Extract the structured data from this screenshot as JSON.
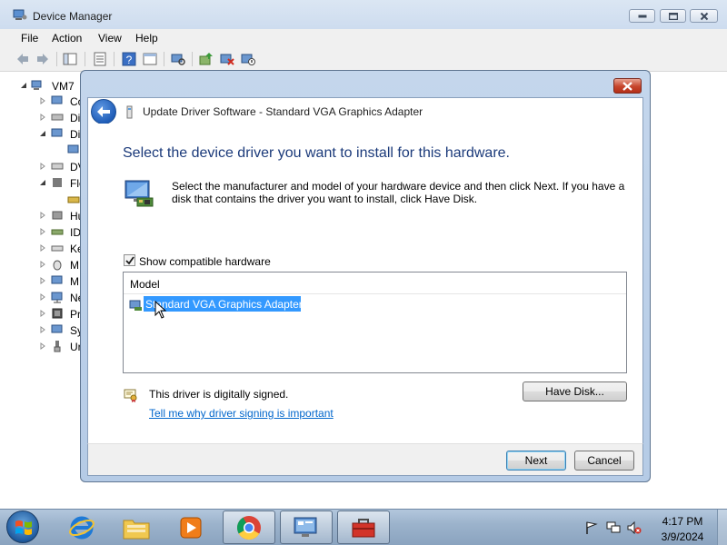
{
  "window": {
    "title": "Device Manager"
  },
  "menu": {
    "items": [
      "File",
      "Action",
      "View",
      "Help"
    ]
  },
  "tree": {
    "root": "VM7",
    "items": [
      "Co",
      "Di",
      "Di",
      "",
      "DV",
      "Flo",
      "",
      "Hu",
      "ID",
      "Ke",
      "M",
      "M",
      "Ne",
      "Pr",
      "Sy",
      "Ur"
    ]
  },
  "dialog": {
    "title": "Update Driver Software - Standard VGA Graphics Adapter",
    "heading": "Select the device driver you want to install for this hardware.",
    "instructions": "Select the manufacturer and model of your hardware device and then click Next. If you have a disk that contains the driver you want to install, click Have Disk.",
    "show_compatible_label": "Show compatible hardware",
    "show_compatible_checked": true,
    "model_header": "Model",
    "models": [
      "Standard VGA Graphics Adapter"
    ],
    "signed_text": "This driver is digitally signed.",
    "signing_link": "Tell me why driver signing is important",
    "have_disk_label": "Have Disk...",
    "next_label": "Next",
    "cancel_label": "Cancel"
  },
  "taskbar": {
    "apps": [
      "internet-explorer-icon",
      "file-explorer-icon",
      "media-player-icon",
      "chrome-icon",
      "device-manager-icon",
      "toolbox-icon"
    ],
    "time": "4:17 PM",
    "date": "3/9/2024"
  },
  "colors": {
    "heading": "#1b3a7a",
    "selection": "#3399ff",
    "link": "#0066cc"
  }
}
